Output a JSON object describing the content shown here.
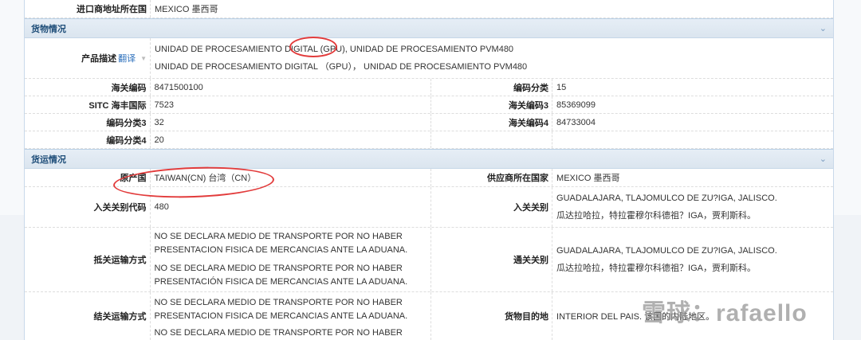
{
  "top_row": {
    "label": "进口商地址所在国",
    "value": "MEXICO  墨西哥"
  },
  "cargo": {
    "title": "货物情况",
    "desc_label": "产品描述",
    "translate": "翻译",
    "desc_lines": [
      "UNIDAD DE PROCESAMIENTO DIGITAL (GPU), UNIDAD DE PROCESAMIENTO PVM480",
      "UNIDAD DE PROCESAMIENTO DIGITAL （GPU）， UNIDAD DE PROCESAMIENTO PVM480"
    ],
    "rows": [
      {
        "l1": "海关编码",
        "v1": "8471500100",
        "l2": "编码分类",
        "v2": "15"
      },
      {
        "l1": "SITC  海丰国际",
        "v1": "7523",
        "l2": "海关编码3",
        "v2": "85369099"
      },
      {
        "l1": "编码分类3",
        "v1": "32",
        "l2": "海关编码4",
        "v2": "84733004"
      },
      {
        "l1": "编码分类4",
        "v1": "20"
      }
    ]
  },
  "shipping": {
    "title": "货运情况",
    "origin_label": "原产国",
    "origin": "TAIWAN(CN)  台湾（CN）",
    "supplier_country_label": "供应商所在国家",
    "supplier_country": "MEXICO  墨西哥",
    "entry_code_label": "入关关别代码",
    "entry_code": "480",
    "entry_port_label": "入关关别",
    "entry_port": [
      "GUADALAJARA, TLAJOMULCO DE ZU?IGA, JALISCO.",
      "瓜达拉哈拉，特拉霍穆尔科德祖？IGA，贾利斯科。"
    ],
    "arrival_mode_label": "抵关运输方式",
    "arrival_mode": [
      "NO SE DECLARA MEDIO DE TRANSPORTE POR NO HABER",
      "PRESENTACION FISICA DE MERCANCIAS ANTE LA ADUANA.",
      "NO SE DECLARA MEDIO DE TRANSPORTE POR NO HABER",
      "PRESENTACIÓN FISICA DE MERCANCIAS ANTE LA ADUANA."
    ],
    "clear_port_label": "通关关别",
    "clear_port": [
      "GUADALAJARA, TLAJOMULCO DE ZU?IGA, JALISCO.",
      "瓜达拉哈拉，特拉霍穆尔科德祖？IGA，贾利斯科。"
    ],
    "exit_mode_label": "结关运输方式",
    "exit_mode": [
      "NO SE DECLARA MEDIO DE TRANSPORTE POR NO HABER",
      "PRESENTACION FISICA DE MERCANCIAS ANTE LA ADUANA.",
      "NO SE DECLARA MEDIO DE TRANSPORTE POR NO HABER"
    ],
    "destination_label": "货物目的地",
    "destination": "INTERIOR DEL PAIS.  该国的内陆地区。"
  },
  "watermark": "雪球：rafaello",
  "colors": {
    "annotation": "#e23b3b",
    "section_text": "#1f4e79"
  }
}
